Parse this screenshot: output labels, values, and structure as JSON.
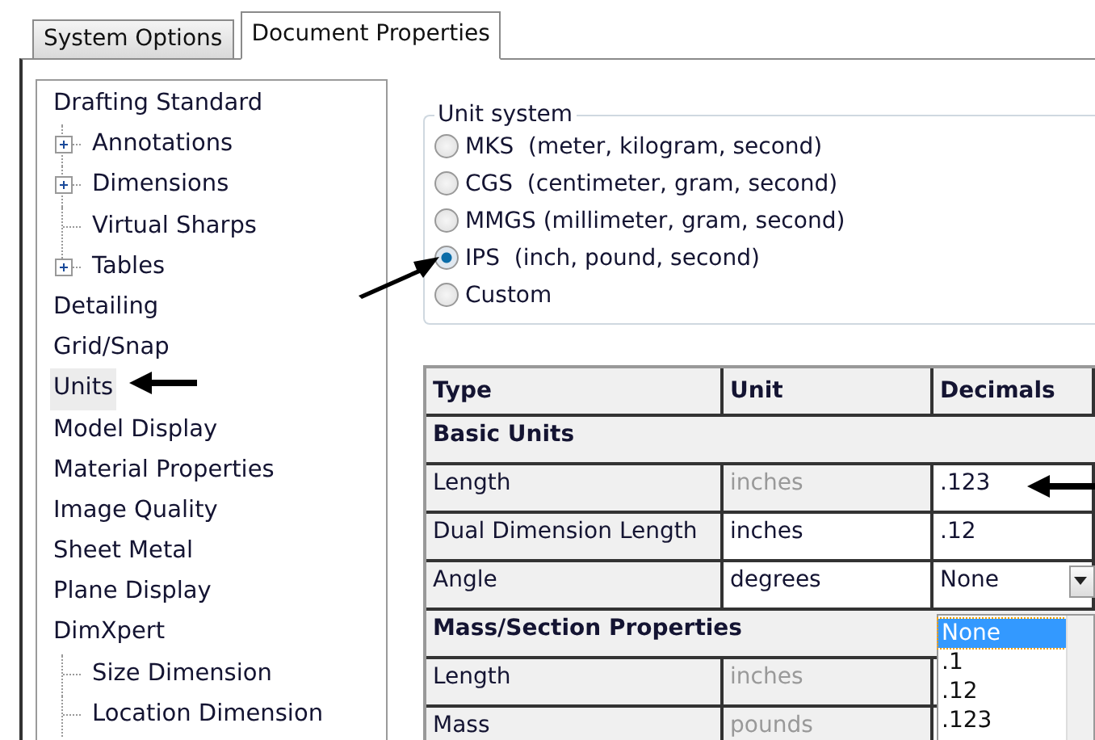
{
  "tabs": [
    {
      "label": "System Options",
      "selected": false
    },
    {
      "label": "Document Properties",
      "selected": true
    }
  ],
  "tree": [
    {
      "label": "Drafting Standard",
      "selected": false,
      "children": [
        {
          "label": "Annotations",
          "selected": false,
          "expandable": true
        },
        {
          "label": "Dimensions",
          "selected": false,
          "expandable": true
        },
        {
          "label": "Virtual Sharps",
          "selected": false,
          "expandable": false
        },
        {
          "label": "Tables",
          "selected": false,
          "expandable": true
        }
      ]
    },
    {
      "label": "Detailing",
      "selected": false
    },
    {
      "label": "Grid/Snap",
      "selected": false
    },
    {
      "label": "Units",
      "selected": true
    },
    {
      "label": "Model Display",
      "selected": false
    },
    {
      "label": "Material Properties",
      "selected": false
    },
    {
      "label": "Image Quality",
      "selected": false
    },
    {
      "label": "Sheet Metal",
      "selected": false
    },
    {
      "label": "Plane Display",
      "selected": false
    },
    {
      "label": "DimXpert",
      "selected": false,
      "children": [
        {
          "label": "Size Dimension",
          "selected": false,
          "expandable": false
        },
        {
          "label": "Location Dimension",
          "selected": false,
          "expandable": false
        }
      ]
    }
  ],
  "unit_system": {
    "title": "Unit system",
    "options": [
      {
        "label": "MKS  (meter, kilogram, second)",
        "selected": false
      },
      {
        "label": "CGS  (centimeter, gram, second)",
        "selected": false
      },
      {
        "label": "MMGS (millimeter, gram, second)",
        "selected": false
      },
      {
        "label": "IPS  (inch, pound, second)",
        "selected": true
      },
      {
        "label": "Custom",
        "selected": false
      }
    ]
  },
  "table": {
    "columns": [
      "Type",
      "Unit",
      "Decimals"
    ],
    "rows": [
      {
        "kind": "section",
        "label": "Basic Units"
      },
      {
        "kind": "row",
        "type": "Length",
        "unit": "inches",
        "unit_disabled": true,
        "decimals": ".123",
        "dropdown": false
      },
      {
        "kind": "row",
        "type": "Dual Dimension Length",
        "unit": "inches",
        "unit_disabled": false,
        "decimals": ".12",
        "dropdown": false
      },
      {
        "kind": "row",
        "type": "Angle",
        "unit": "degrees",
        "unit_disabled": false,
        "decimals": "None",
        "dropdown": true
      },
      {
        "kind": "section",
        "label": "Mass/Section Properties"
      },
      {
        "kind": "row",
        "type": "Length",
        "unit": "inches",
        "unit_disabled": true,
        "decimals": "",
        "dropdown": false
      },
      {
        "kind": "row",
        "type": "Mass",
        "unit": "pounds",
        "unit_disabled": true,
        "decimals": "",
        "dropdown": false
      }
    ]
  },
  "dropdown_list": [
    {
      "label": "None",
      "selected": true
    },
    {
      "label": ".1",
      "selected": false
    },
    {
      "label": ".12",
      "selected": false
    },
    {
      "label": ".123",
      "selected": false
    }
  ]
}
